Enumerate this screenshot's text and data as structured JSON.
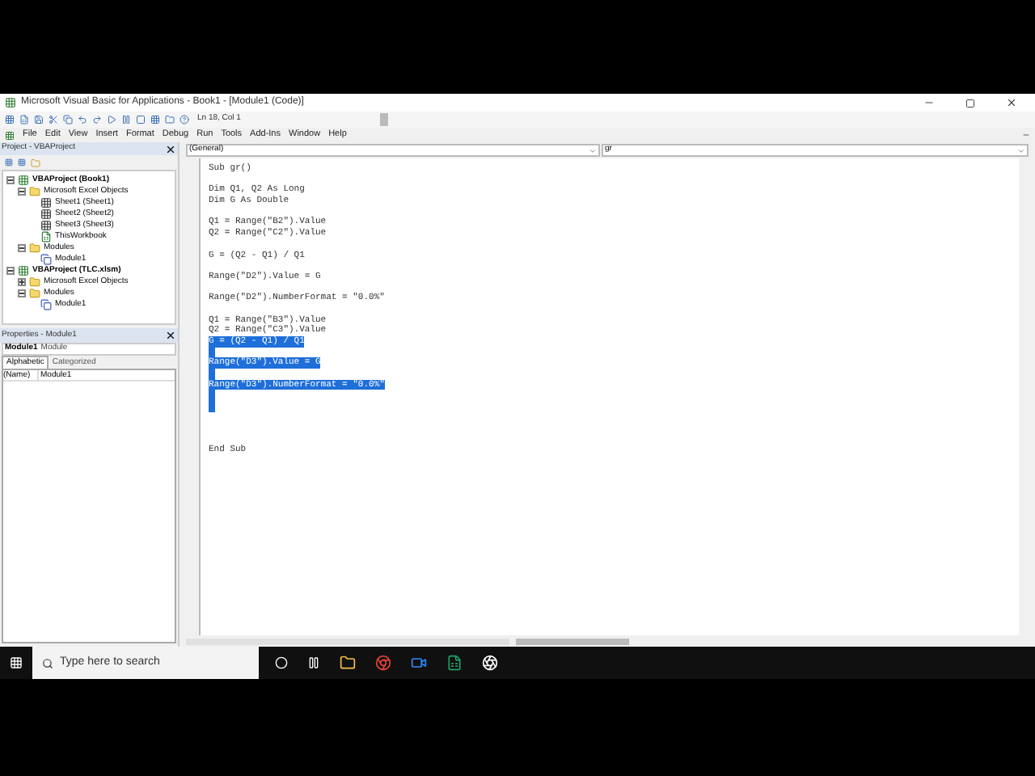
{
  "window": {
    "title": "Microsoft Visual Basic for Applications - Book1 - [Module1 (Code)]"
  },
  "toolbar": {
    "position": "Ln 18, Col 1"
  },
  "menu": [
    "File",
    "Edit",
    "View",
    "Insert",
    "Format",
    "Debug",
    "Run",
    "Tools",
    "Add-Ins",
    "Window",
    "Help"
  ],
  "project_pane": {
    "title": "Project - VBAProject",
    "tree": [
      {
        "label": "VBAProject (Book1)",
        "kind": "project",
        "expanded": true,
        "children": [
          {
            "label": "Microsoft Excel Objects",
            "kind": "folder",
            "expanded": true,
            "children": [
              {
                "label": "Sheet1 (Sheet1)",
                "kind": "sheet"
              },
              {
                "label": "Sheet2 (Sheet2)",
                "kind": "sheet"
              },
              {
                "label": "Sheet3 (Sheet3)",
                "kind": "sheet"
              },
              {
                "label": "ThisWorkbook",
                "kind": "workbook"
              }
            ]
          },
          {
            "label": "Modules",
            "kind": "folder",
            "expanded": true,
            "children": [
              {
                "label": "Module1",
                "kind": "module"
              }
            ]
          }
        ]
      },
      {
        "label": "VBAProject (TLC.xlsm)",
        "kind": "project",
        "expanded": true,
        "children": [
          {
            "label": "Microsoft Excel Objects",
            "kind": "folder",
            "expanded": false
          },
          {
            "label": "Modules",
            "kind": "folder",
            "expanded": true,
            "children": [
              {
                "label": "Module1",
                "kind": "module"
              }
            ]
          }
        ]
      }
    ]
  },
  "properties_pane": {
    "title": "Properties - Module1",
    "object": "Module1",
    "object_type": "Module",
    "tabs": [
      {
        "label": "Alphabetic",
        "selected": true
      },
      {
        "label": "Categorized",
        "selected": false
      }
    ],
    "rows": [
      {
        "name": "(Name)",
        "value": "Module1"
      }
    ]
  },
  "code": {
    "object": "(General)",
    "procedure": "gr",
    "lines": [
      {
        "text": "Sub gr()",
        "selected": false
      },
      {
        "selected": false
      },
      {
        "text": "Dim Q1, Q2 As Long",
        "selected": false
      },
      {
        "text": "Dim G As Double",
        "selected": false
      },
      {
        "selected": false
      },
      {
        "text": "Q1 = Range(\"B2\").Value",
        "selected": false
      },
      {
        "text": "Q2 = Range(\"C2\").Value",
        "selected": false
      },
      {
        "selected": false
      },
      {
        "text": "G = (Q2 - Q1) / Q1",
        "selected": false
      },
      {
        "selected": false
      },
      {
        "text": "Range(\"D2\").Value = G",
        "selected": false
      },
      {
        "selected": false
      },
      {
        "text": "Range(\"D2\").NumberFormat = \"0.0%\"",
        "selected": false
      },
      {
        "selected": false
      },
      {
        "text": "Q1 = Range(\"B3\").Value",
        "selected": false
      },
      {
        "text": "Q2 = Range(\"C3\").Value",
        "selected": false
      },
      {
        "text": "G = (Q2 - Q1) / Q1",
        "selected": true
      },
      {
        "selected": true
      },
      {
        "text": "Range(\"D3\").Value = G",
        "selected": true
      },
      {
        "selected": true
      },
      {
        "text": "Range(\"D3\").NumberFormat = \"0.0%\"",
        "selected": true
      },
      {
        "selected": true
      },
      {
        "selected": true
      },
      {
        "selected": false
      },
      {
        "selected": false
      },
      {
        "selected": false
      },
      {
        "text": "End Sub",
        "selected": false
      }
    ]
  },
  "taskbar": {
    "search_placeholder": "Type here to search"
  }
}
